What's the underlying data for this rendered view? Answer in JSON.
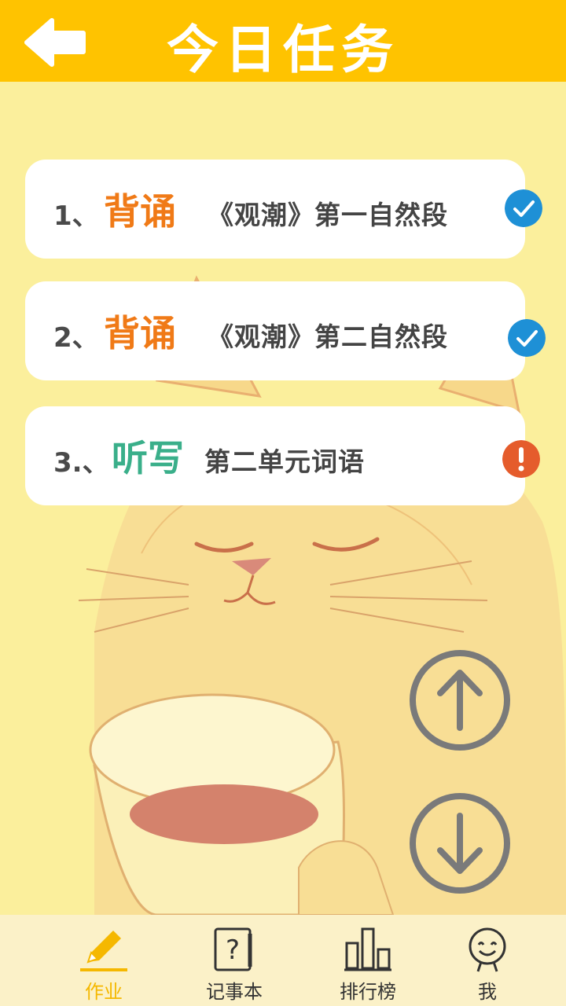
{
  "header": {
    "title": "今日任务",
    "back_icon": "back-arrow-icon"
  },
  "tasks": [
    {
      "number": "1、",
      "verb": "背诵",
      "object": "《观潮》第一自然段",
      "verb_color": "#f07a17",
      "status": "done",
      "status_icon": "check-icon",
      "status_color": "#1e90d6"
    },
    {
      "number": "2、",
      "verb": "背诵",
      "object": "《观潮》第二自然段",
      "verb_color": "#f07a17",
      "status": "done",
      "status_icon": "check-icon",
      "status_color": "#1e90d6"
    },
    {
      "number": "3.、",
      "verb": "听写",
      "object": "第二单元词语",
      "verb_color": "#3aaf8a",
      "status": "pending",
      "status_icon": "exclamation-icon",
      "status_color": "#e55c2c"
    }
  ],
  "controls": {
    "up_icon": "arrow-up-icon",
    "down_icon": "arrow-down-icon"
  },
  "nav": {
    "items": [
      {
        "label": "作业",
        "icon": "pencil-icon",
        "active": true
      },
      {
        "label": "记事本",
        "icon": "notebook-icon",
        "active": false
      },
      {
        "label": "排行榜",
        "icon": "bar-chart-icon",
        "active": false
      },
      {
        "label": "我",
        "icon": "smiley-icon",
        "active": false
      }
    ],
    "active_color": "#f5b800"
  },
  "colors": {
    "header": "#ffc300",
    "background": "#fbef9c",
    "nav_background": "#fbf1c8"
  }
}
